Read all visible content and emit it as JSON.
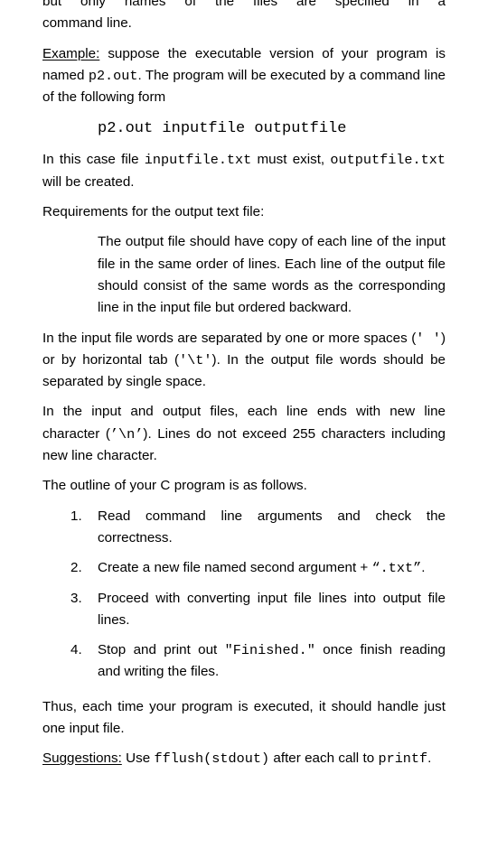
{
  "document": {
    "page_background": "#ffffff",
    "text_color": "#000000",
    "clipped_top_line": "but only names of the files are specified in a",
    "para_command_line_tail": "command line.",
    "example": {
      "label": "Example:",
      "text_before_code": "suppose the executable version of your program is named ",
      "code_program": "p2.out",
      "text_after_code": ". The program will be executed by a command line of the following form"
    },
    "command_example": "p2.out inputfile outputfile",
    "case_para": {
      "lead": "In this case file ",
      "code_input": "inputfile.txt",
      "mid": " must exist, ",
      "code_output": "outputfile.txt",
      "tail": " will be created."
    },
    "requirements_heading": "Requirements for the output text file:",
    "requirements_body": "The output file should have copy of each line of the input file in the same order of lines. Each line of the output file should consist of the same words as the corresponding line in the input file but ordered backward.",
    "separators_para": {
      "p1": "In the input file words are separated by one or more spaces (",
      "code_space": "'  '",
      "p2": ") or by horizontal tab (",
      "code_tab": "'\\t'",
      "p3": "). In the output file words should be separated by single space."
    },
    "newline_para": {
      "p1": "In the input and output files, each line ends with new line character (",
      "code_newline": "’\\n’",
      "p2": "). Lines do not exceed 255 characters including new line character."
    },
    "outline_intro": "The outline of your C program is as follows.",
    "outline_items": [
      {
        "marker": "1.",
        "text": "Read command line arguments and check the correctness."
      },
      {
        "marker": "2.",
        "text_before": "Create a new file named second argument + ",
        "code": "“.txt”",
        "text_after": "."
      },
      {
        "marker": "3.",
        "text": "Proceed with converting input file lines into output file lines."
      },
      {
        "marker": "4.",
        "text_before": "Stop and print out ",
        "code": "\"Finished.\"",
        "text_after": " once finish reading and writing the files."
      }
    ],
    "thus_para": "Thus, each time your program is executed, it should handle just one input file.",
    "suggestions": {
      "label": "Suggestions:",
      "text_before": "Use ",
      "code_fflush": "fflush(stdout)",
      "text_mid": " after each call to ",
      "code_printf": "printf",
      "text_after": "."
    }
  }
}
